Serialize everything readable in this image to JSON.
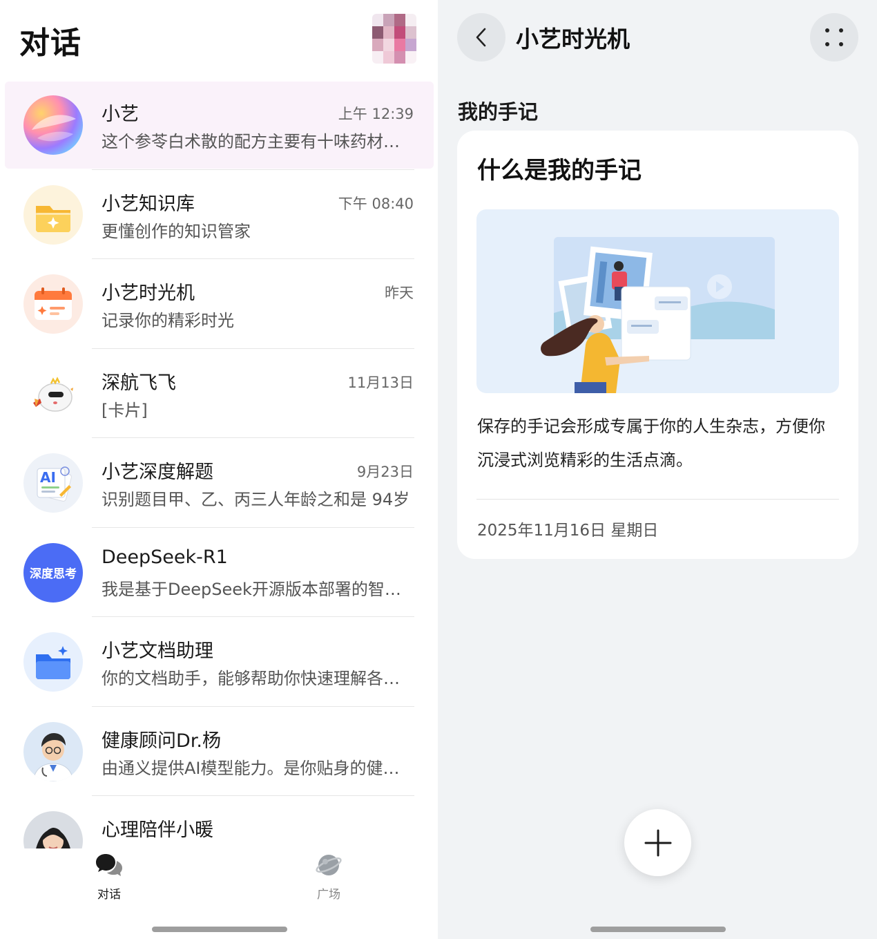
{
  "left": {
    "title": "对话",
    "conversations": [
      {
        "name": "小艺",
        "time": "上午 12:39",
        "preview": "这个参苓白术散的配方主要有十味药材及其作用",
        "avatar": "xiaoyi-orb-icon"
      },
      {
        "name": "小艺知识库",
        "time": "下午 08:40",
        "preview": "更懂创作的知识管家",
        "avatar": "folder-icon"
      },
      {
        "name": "小艺时光机",
        "time": "昨天",
        "preview": "记录你的精彩时光",
        "avatar": "calendar-icon"
      },
      {
        "name": "深航飞飞",
        "time": "11月13日",
        "preview": "[卡片]",
        "avatar": "mascot-icon"
      },
      {
        "name": "小艺深度解题",
        "time": "9月23日",
        "preview": "识别题目甲、乙、丙三人年龄之和是 94岁",
        "avatar": "ai-notebook-icon"
      },
      {
        "name": "DeepSeek-R1",
        "time": "",
        "preview": "我是基于DeepSeek开源版本部署的智能助手",
        "avatar": "deep-think-badge",
        "avatar_text": "深度思考"
      },
      {
        "name": "小艺文档助理",
        "time": "",
        "preview": "你的文档助手，能够帮助你快速理解各类文档",
        "avatar": "blue-folder-icon"
      },
      {
        "name": "健康顾问Dr.杨",
        "time": "",
        "preview": "由通义提供AI模型能力。是你贴身的健康顾问",
        "avatar": "doctor-avatar"
      },
      {
        "name": "心理陪伴小暖",
        "time": "",
        "preview": "",
        "avatar": "woman-avatar"
      }
    ],
    "tabs": [
      {
        "label": "对话",
        "icon": "chat-bubbles-icon",
        "active": true
      },
      {
        "label": "广场",
        "icon": "planet-icon",
        "active": false
      }
    ]
  },
  "right": {
    "title": "小艺时光机",
    "section_label": "我的手记",
    "card": {
      "title": "什么是我的手记",
      "description": "保存的手记会形成专属于你的人生杂志，方便你沉浸式浏览精彩的生活点滴。",
      "date": "2025年11月16日 星期日"
    },
    "fab_icon": "plus-icon"
  },
  "colors": {
    "active_row_bg": "#faf2fa",
    "right_bg": "#f1f3f5",
    "deepseek_blue": "#4b6cf5"
  }
}
